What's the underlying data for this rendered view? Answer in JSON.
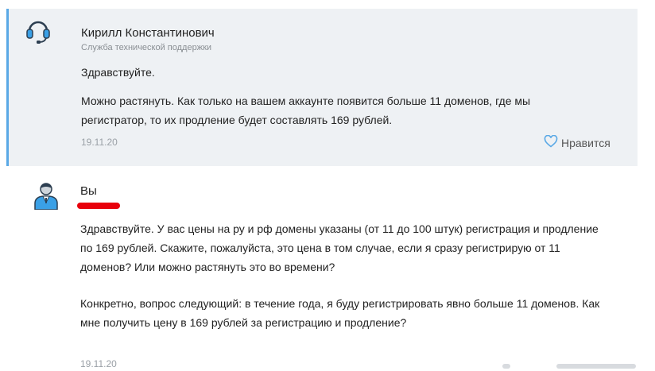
{
  "support_message": {
    "author_name": "Кирилл Константинович",
    "author_role": "Служба технической поддержки",
    "greeting": "Здравствуйте.",
    "body": "Можно растянуть. Как только на вашем аккаунте появится больше 11 доменов, где мы регистратор, то их продление будет составлять 169 рублей.",
    "date": "19.11.20",
    "like_label": "Нравится"
  },
  "user_message": {
    "author_name": "Вы",
    "paragraph1": "Здравствуйте. У вас цены на ру и рф домены указаны (от 11 до 100 штук) регистрация и продление по 169 рублей. Скажите, пожалуйста, это цена в том случае, если я сразу регистрирую от 11 доменов? Или можно растянуть это во времени?",
    "paragraph2": "Конкретно, вопрос следующий: в течение года, я буду регистрировать явно больше 11 доменов. Как мне получить цену в 169 рублей за регистрацию и продление?",
    "date": "19.11.20"
  },
  "colors": {
    "support_bg": "#eef1f4",
    "accent": "#5aa9e6",
    "redaction": "#e8000b"
  },
  "icons": {
    "support_avatar": "headset-icon",
    "user_avatar": "user-suit-icon",
    "like": "heart-icon"
  }
}
